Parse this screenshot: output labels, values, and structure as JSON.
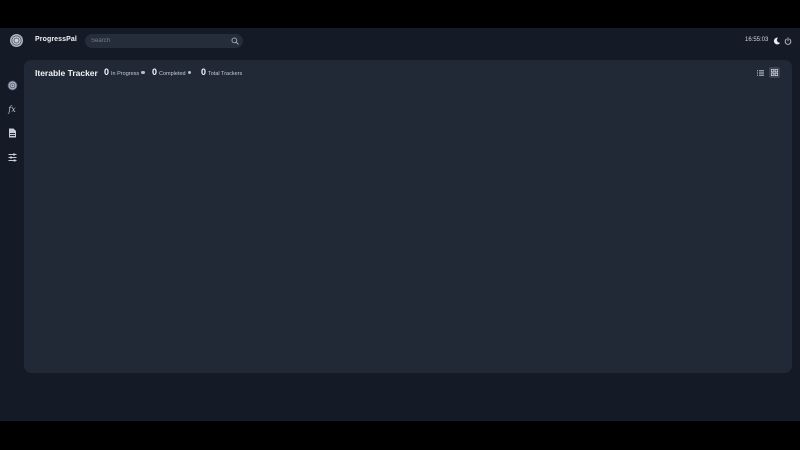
{
  "app": {
    "name": "ProgressPal"
  },
  "search": {
    "placeholder": "Search",
    "value": ""
  },
  "clock": {
    "time": "16:55:03"
  },
  "sidebar": {
    "items": [
      {
        "name": "dashboard",
        "icon": "spiral-logo-icon"
      },
      {
        "name": "functions",
        "icon": "fx-icon",
        "label": "fx"
      },
      {
        "name": "files",
        "icon": "file-icon"
      },
      {
        "name": "settings",
        "icon": "sliders-icon"
      }
    ]
  },
  "panel": {
    "title": "Iterable Tracker",
    "stats": [
      {
        "value": "0",
        "label": "In Progress"
      },
      {
        "value": "0",
        "label": "Completed"
      },
      {
        "value": "0",
        "label": "Total Trackers"
      }
    ],
    "view_modes": [
      "list-view-icon",
      "grid-view-icon"
    ],
    "active_view": "grid"
  },
  "colors": {
    "background": "#141a26",
    "panel": "#212836",
    "search_bg": "#252c3a",
    "text": "#f2f4f8"
  }
}
